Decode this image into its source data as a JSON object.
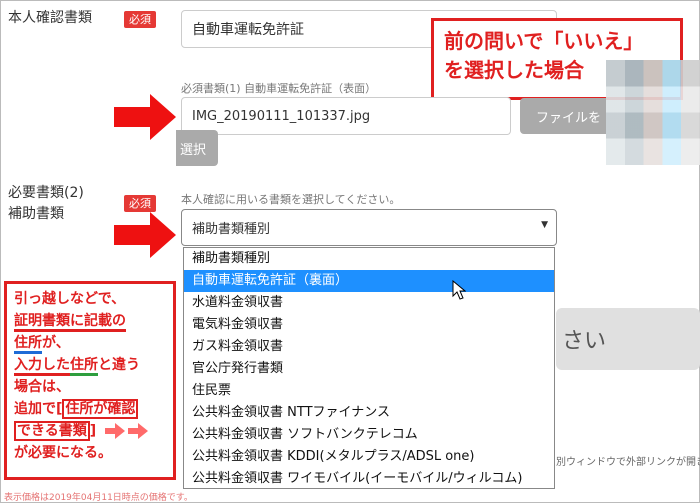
{
  "form": {
    "identity_label": "本人確認書類",
    "required_badge": "必須",
    "document_type_value": "自動車運転免許証",
    "required_doc_caption": "必須書類(1) 自動車運転免許証（表面）",
    "file_name": "IMG_20190111_101337.jpg",
    "file_button_label": "ファイルを",
    "file_button_label_cont": "選択",
    "required_doc2_label_line1": "必要書類(2)",
    "required_doc2_label_line2": "補助書類",
    "aux_instruction": "本人確認に用いる書類を選択してください。",
    "aux_select_value": "補助書類種別"
  },
  "dropdown": {
    "options": [
      "補助書類種別",
      "自動車運転免許証（裏面）",
      "水道料金領収書",
      "電気料金領収書",
      "ガス料金領収書",
      "官公庁発行書類",
      "住民票",
      "公共料金領収書 NTTファイナンス",
      "公共料金領収書 ソフトバンクテレコム",
      "公共料金領収書 KDDI(メタルプラス/ADSL one)",
      "公共料金領収書 ワイモバイル(イーモバイル/ウィルコム)"
    ],
    "selected_index": 1
  },
  "callout_top": {
    "line1": "前の問いで「いいえ」",
    "line2": "を選択した場合"
  },
  "callout_left": {
    "l1": "引っ越しなどで、",
    "l2": "証明書類に記載の",
    "l3": "住所",
    "l3b": "が、",
    "l4a": "入力した",
    "l4b": "住所",
    "l4c": "と違う",
    "l5": "場合は、",
    "l6a": "追加で[",
    "l6b": "住所が確認",
    "l7a": "できる書類",
    "l7b": "]",
    "l8": "が必要になる。"
  },
  "background": {
    "big_button_fragment": "さい",
    "new_window_note": "別ウィンドウで外部リンクが開き",
    "footer_note": "表示価格は2019年04月11日時点の価格です。"
  },
  "colors": {
    "accent_red": "#e02020",
    "selection_blue": "#1e90ff"
  }
}
